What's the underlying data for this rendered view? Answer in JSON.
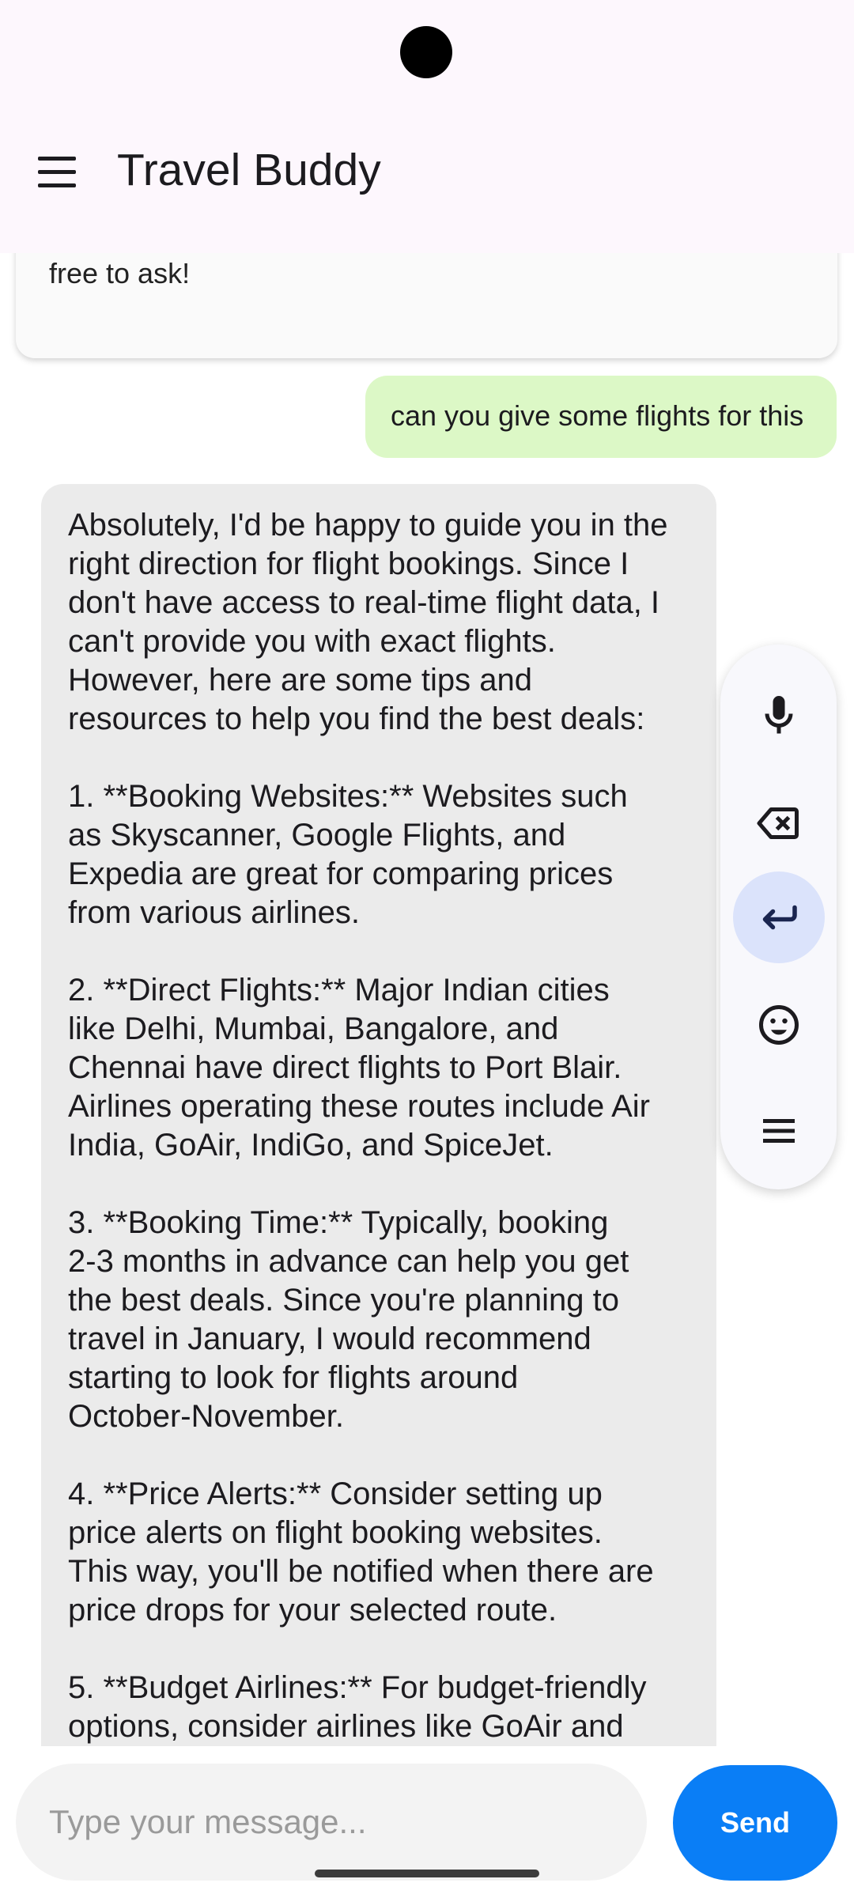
{
  "app": {
    "title": "Travel Buddy"
  },
  "messages": [
    {
      "role": "assistant",
      "text": "sports. If you need any more details or assistance, feel\nfree to ask!"
    },
    {
      "role": "user",
      "text": "can you give some flights for this"
    },
    {
      "role": "assistant",
      "text": "Absolutely, I'd be happy to guide you in the\nright direction for flight bookings. Since I\ndon't have access to real-time flight data, I\ncan't provide you with exact flights.\nHowever, here are some tips and\nresources to help you find the best deals:\n\n1. **Booking Websites:** Websites such\nas Skyscanner, Google Flights, and\nExpedia are great for comparing prices\nfrom various airlines.\n\n2. **Direct Flights:** Major Indian cities\nlike Delhi, Mumbai, Bangalore, and\nChennai have direct flights to Port Blair.\nAirlines operating these routes include Air\nIndia, GoAir, IndiGo, and SpiceJet.\n\n3. **Booking Time:** Typically, booking\n2-3 months in advance can help you get\nthe best deals. Since you're planning to\ntravel in January, I would recommend\nstarting to look for flights around\nOctober-November.\n\n4. **Price Alerts:** Consider setting up\nprice alerts on flight booking websites.\nThis way, you'll be notified when there are\nprice drops for your selected route.\n\n5. **Budget Airlines:** For budget-friendly\noptions, consider airlines like GoAir and"
    }
  ],
  "composer": {
    "placeholder": "Type your message...",
    "send_label": "Send"
  },
  "keyboard_toolbar": {
    "buttons": [
      {
        "icon": "microphone-icon",
        "active": false
      },
      {
        "icon": "backspace-icon",
        "active": false
      },
      {
        "icon": "enter-icon",
        "active": true
      },
      {
        "icon": "emoji-icon",
        "active": false
      },
      {
        "icon": "menu-icon",
        "active": false
      }
    ]
  },
  "colors": {
    "user_bubble": "#dcf8c6",
    "bot_bubble": "#ebebeb",
    "send_button": "#0a7ef6",
    "app_bar": "#fdf7fd"
  }
}
